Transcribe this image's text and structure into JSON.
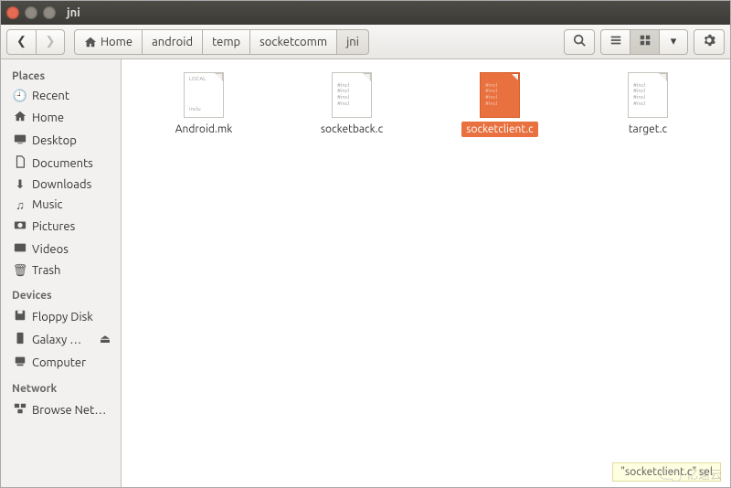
{
  "window": {
    "title": "jni"
  },
  "toolbar": {
    "home_label": "Home",
    "path": [
      "android",
      "temp",
      "socketcomm",
      "jni"
    ],
    "active_segment": 3
  },
  "sidebar": {
    "places_header": "Places",
    "places": [
      {
        "icon": "clock",
        "label": "Recent"
      },
      {
        "icon": "home",
        "label": "Home"
      },
      {
        "icon": "desktop",
        "label": "Desktop"
      },
      {
        "icon": "doc",
        "label": "Documents"
      },
      {
        "icon": "download",
        "label": "Downloads"
      },
      {
        "icon": "music",
        "label": "Music"
      },
      {
        "icon": "camera",
        "label": "Pictures"
      },
      {
        "icon": "video",
        "label": "Videos"
      },
      {
        "icon": "trash",
        "label": "Trash"
      }
    ],
    "devices_header": "Devices",
    "devices": [
      {
        "icon": "disk",
        "label": "Floppy Disk",
        "eject": false
      },
      {
        "icon": "phone",
        "label": "Galaxy …",
        "eject": true
      },
      {
        "icon": "computer",
        "label": "Computer",
        "eject": false
      }
    ],
    "network_header": "Network",
    "network": [
      {
        "icon": "net",
        "label": "Browse Net…"
      }
    ]
  },
  "files": [
    {
      "name": "Android.mk",
      "type": "mk",
      "selected": false
    },
    {
      "name": "socketback.c",
      "type": "c",
      "selected": false
    },
    {
      "name": "socketclient.c",
      "type": "c",
      "selected": true
    },
    {
      "name": "target.c",
      "type": "c",
      "selected": false
    }
  ],
  "status": "\"socketclient.c\" sel",
  "watermark": "亿速云"
}
